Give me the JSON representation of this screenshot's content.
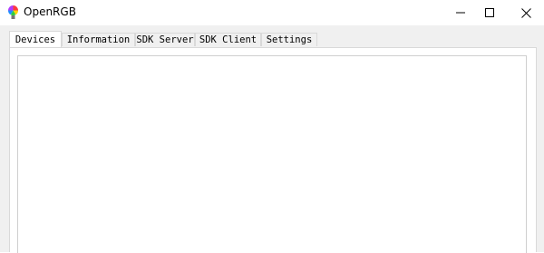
{
  "window": {
    "title": "OpenRGB",
    "icon": "openrgb-logo-icon",
    "controls": {
      "minimize": "minimize-icon",
      "maximize": "maximize-icon",
      "close": "close-icon"
    }
  },
  "tabs": [
    {
      "label": "Devices",
      "active": true
    },
    {
      "label": "Information",
      "active": false
    },
    {
      "label": "SDK Server",
      "active": false
    },
    {
      "label": "SDK Client",
      "active": false
    },
    {
      "label": "Settings",
      "active": false
    }
  ],
  "devices_panel": {
    "items": []
  }
}
